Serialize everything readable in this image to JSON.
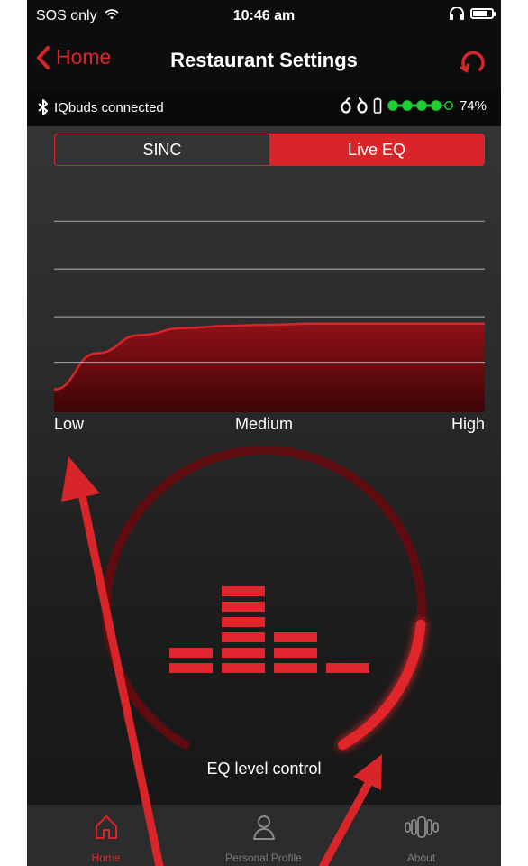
{
  "status_bar": {
    "carrier": "SOS only",
    "time": "10:46 am"
  },
  "nav": {
    "back_label": "Home",
    "title": "Restaurant Settings"
  },
  "connection": {
    "text": "IQbuds connected",
    "battery_percent": "74%",
    "battery_level": 0.74
  },
  "segments": [
    {
      "label": "SINC",
      "active": false
    },
    {
      "label": "Live EQ",
      "active": true
    }
  ],
  "chart_data": {
    "type": "area",
    "categories": [
      "Low",
      "Medium",
      "High"
    ],
    "x": [
      0,
      0.1,
      0.2,
      0.3,
      0.4,
      0.5,
      0.6,
      0.7,
      0.8,
      0.9,
      1.0
    ],
    "values": [
      0.1,
      0.26,
      0.34,
      0.37,
      0.38,
      0.385,
      0.39,
      0.39,
      0.39,
      0.39,
      0.39
    ],
    "ylim": [
      0,
      1
    ],
    "grid": true,
    "color": "#d8252a"
  },
  "eq_control": {
    "label": "EQ level control",
    "level": 0.82
  },
  "tabs": [
    {
      "label": "Home",
      "icon": "home-icon",
      "active": true
    },
    {
      "label": "Personal Profile",
      "icon": "profile-icon",
      "active": false
    },
    {
      "label": "About",
      "icon": "about-icon",
      "active": false
    }
  ],
  "colors": {
    "accent": "#d8252a",
    "battery_green": "#22cc33"
  }
}
